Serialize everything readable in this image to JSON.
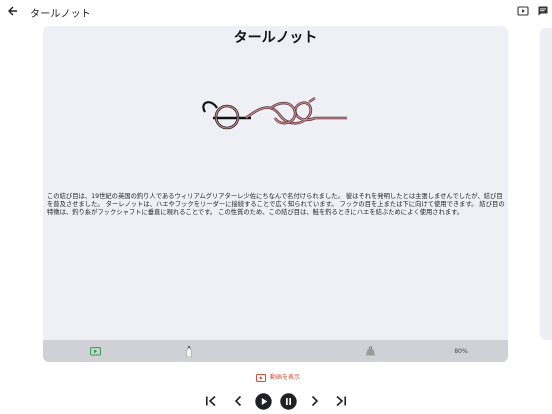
{
  "app": {
    "title": "タールノット",
    "back_icon": "arrow-back-icon",
    "actions": [
      "video-icon",
      "chat-icon"
    ]
  },
  "knot": {
    "title": "タールノット",
    "description": "この結び目は、19世紀の英国の釣り人であるウィリアムグリアターレ少佐にちなんで名付けられました。 彼はそれを発明したとは主張しませんでしたが、結び目を普及させました。 ターレノットは、ハエやフックをリーダーに接続することで広く知られています。 フックの目を上または下に向けて使用できます。 結び目の特徴は、釣り糸がフックシャフトに垂直に現れることです。 この性質のため、この結び目は、鮭を釣るときにハエを結ぶためによく使用されます。",
    "line_color": "#c98a8f"
  },
  "toolbar": {
    "zoom": "80%",
    "icons": [
      "play-video-icon",
      "bottle-icon",
      "weight-icon"
    ],
    "accent": "#2e9e4a"
  },
  "video_link": {
    "label": "動画を表示",
    "color": "#d84a3a"
  },
  "controls": [
    "skip-first-icon",
    "previous-icon",
    "play-icon",
    "pause-icon",
    "next-icon",
    "skip-last-icon"
  ]
}
